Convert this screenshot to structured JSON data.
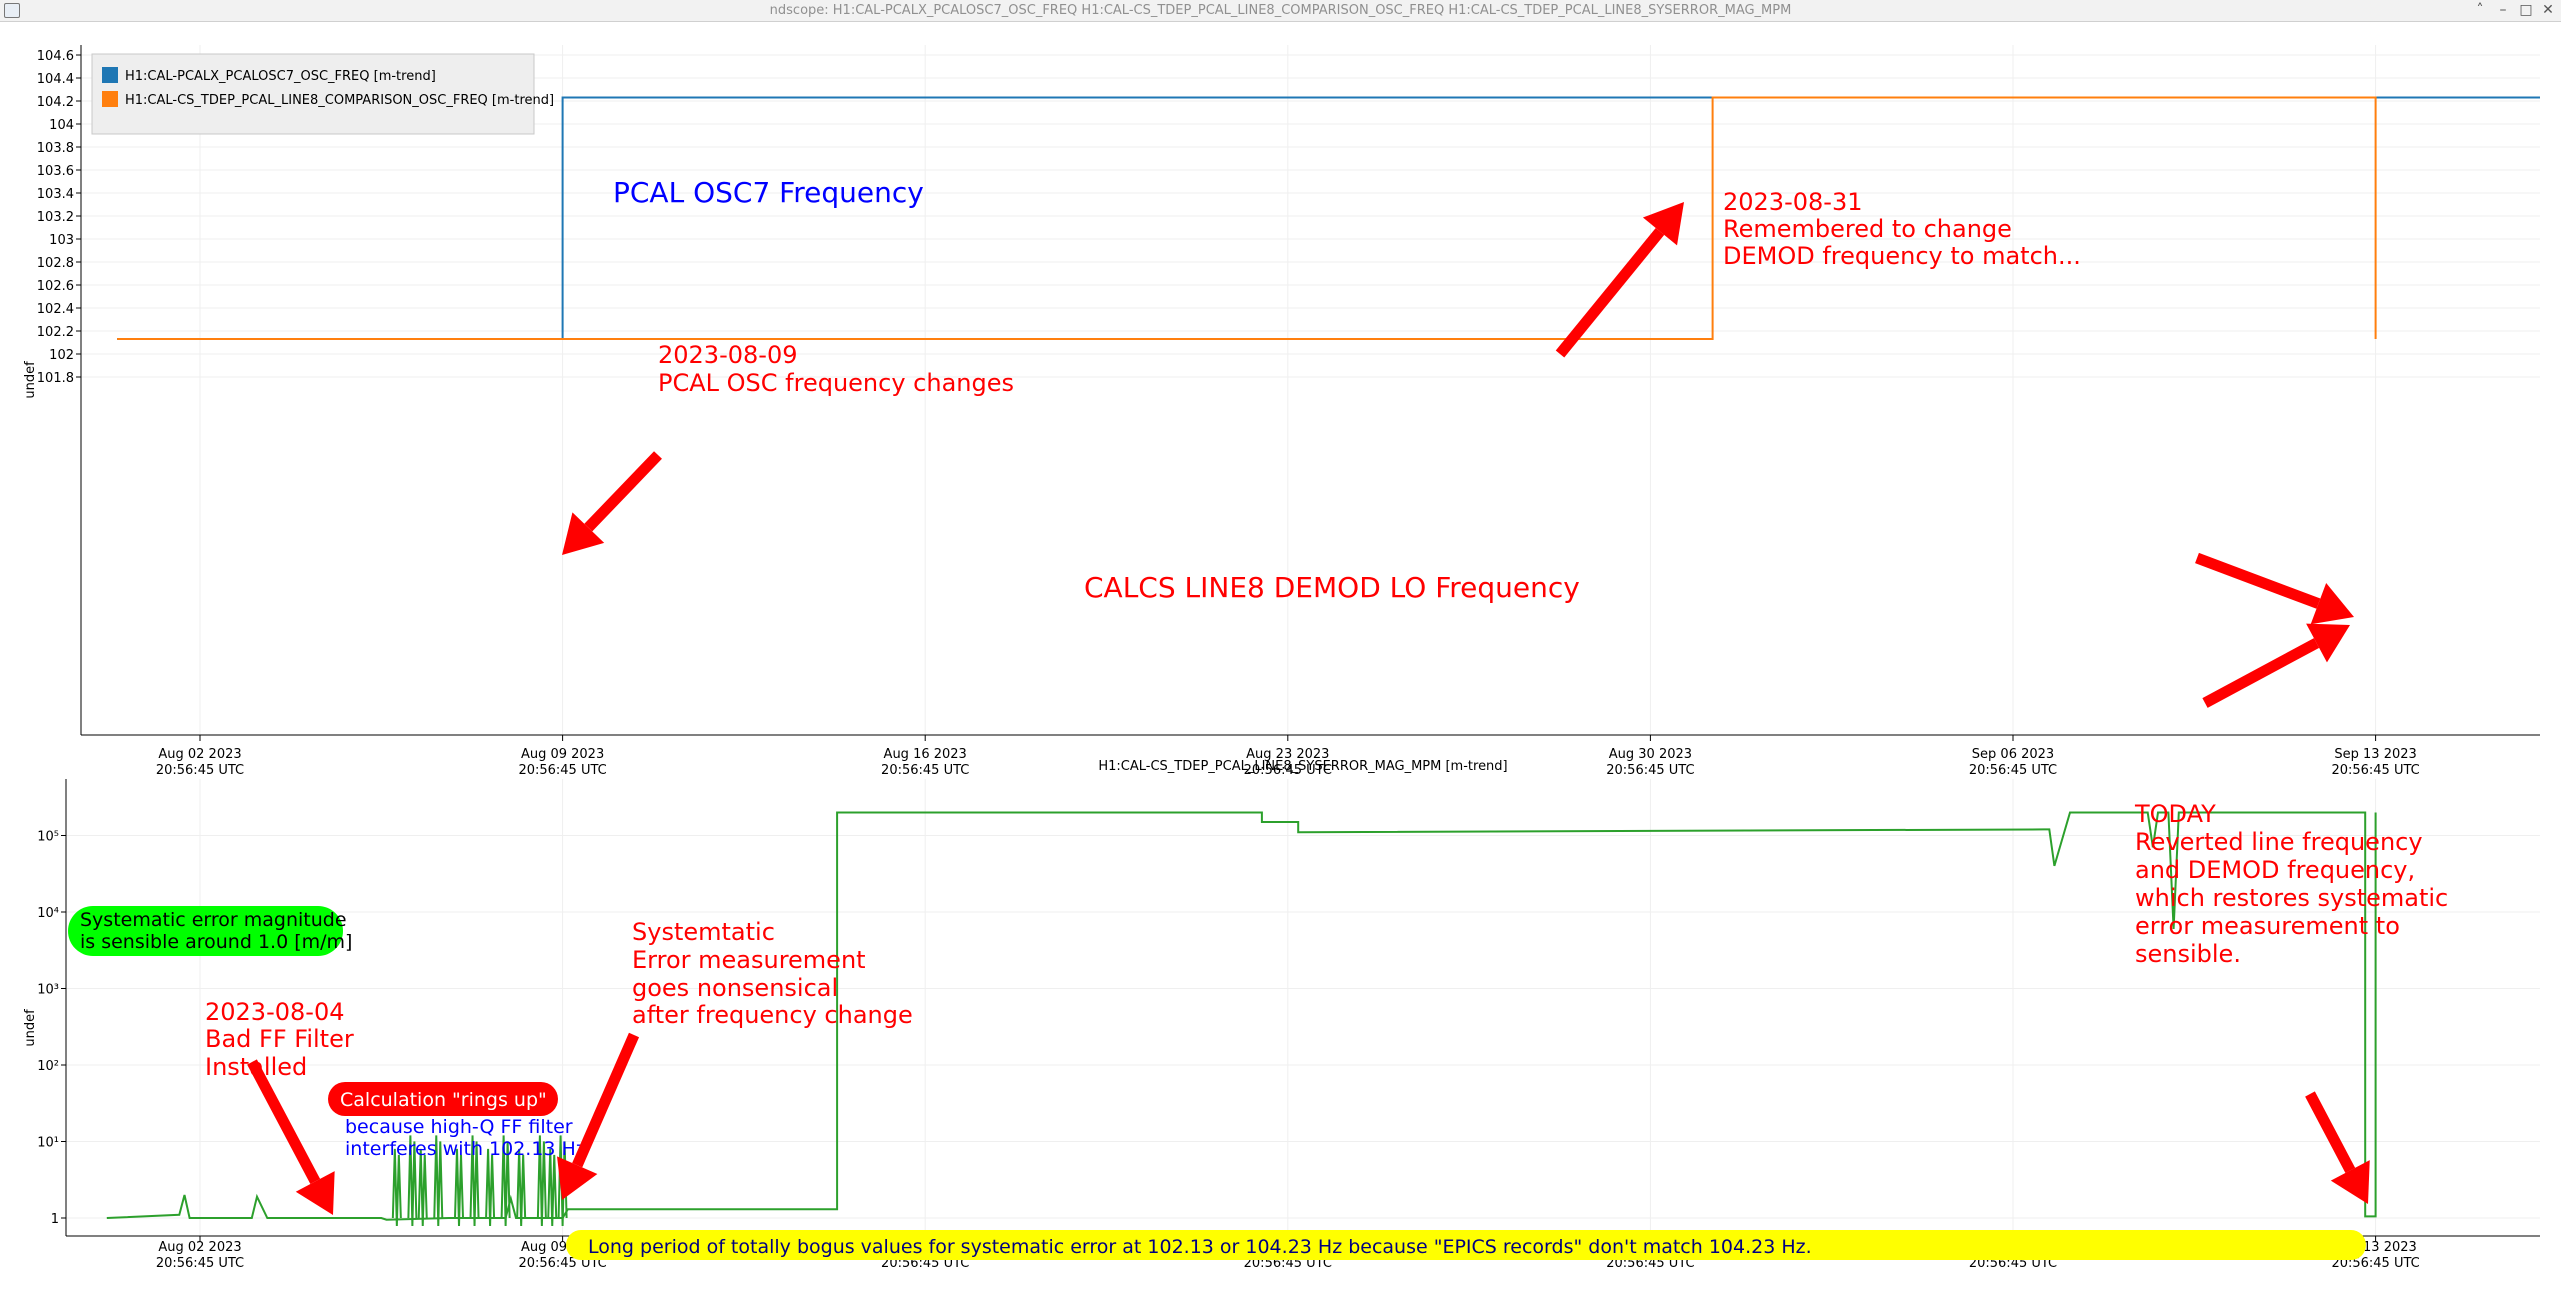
{
  "window": {
    "title": "ndscope: H1:CAL-PCALX_PCALOSC7_OSC_FREQ H1:CAL-CS_TDEP_PCAL_LINE8_COMPARISON_OSC_FREQ H1:CAL-CS_TDEP_PCAL_LINE8_SYSERROR_MAG_MPM",
    "controls": [
      "˄",
      "–",
      "□",
      "✕"
    ]
  },
  "colors": {
    "blue": "#1f77b4",
    "orange": "#ff7f0e",
    "green": "#2ca02c",
    "red": "#ff0000",
    "yellow": "#ffff00",
    "lime": "#00ff00"
  },
  "chart_data": [
    {
      "type": "line",
      "ylabel": "undef",
      "ylim": [
        101.7,
        104.65
      ],
      "x_ticks": [
        [
          "Aug 02 2023",
          "20:56:45 UTC"
        ],
        [
          "Aug 09 2023",
          "20:56:45 UTC"
        ],
        [
          "Aug 16 2023",
          "20:56:45 UTC"
        ],
        [
          "Aug 23 2023",
          "20:56:45 UTC"
        ],
        [
          "Aug 30 2023",
          "20:56:45 UTC"
        ],
        [
          "Sep 06 2023",
          "20:56:45 UTC"
        ],
        [
          "Sep 13 2023",
          "20:56:45 UTC"
        ]
      ],
      "y_ticks": [
        "104.6",
        "104.4",
        "104.2",
        "104",
        "103.8",
        "103.6",
        "103.4",
        "103.2",
        "103",
        "102.8",
        "102.6",
        "102.4",
        "102.2",
        "102",
        "101.8"
      ],
      "grid": true,
      "legend_position": "top-left",
      "series": [
        {
          "name": "H1:CAL-PCALX_PCALOSC7_OSC_FREQ [m-trend]",
          "color": "#1f77b4",
          "x_days": [
            -1.6,
            7.0,
            7.0,
            46.0
          ],
          "y": [
            102.13,
            102.13,
            104.23,
            104.23
          ]
        },
        {
          "name": "H1:CAL-CS_TDEP_PCAL_LINE8_COMPARISON_OSC_FREQ [m-trend]",
          "color": "#ff7f0e",
          "x_days": [
            -1.6,
            29.2,
            29.2,
            42.0,
            42.0
          ],
          "y": [
            102.13,
            102.13,
            104.23,
            104.23,
            102.13
          ]
        }
      ],
      "annotations": [
        {
          "text": "PCAL OSC7 Frequency",
          "color": "#0000ff"
        },
        {
          "lines": [
            "2023-08-09",
            "PCAL OSC frequency changes"
          ],
          "color": "#ff0000"
        },
        {
          "lines": [
            "2023-08-31",
            "Remembered to change",
            "DEMOD frequency to match..."
          ],
          "color": "#ff0000"
        },
        {
          "text": "CALCS LINE8 DEMOD LO Frequency",
          "color": "#ff0000"
        }
      ]
    },
    {
      "type": "line",
      "title": "H1:CAL-CS_TDEP_PCAL_LINE8_SYSERROR_MAG_MPM [m-trend]",
      "ylabel": "undef",
      "scale": "log",
      "y_ticks": [
        "10⁵",
        "10⁴",
        "10³",
        "10²",
        "10¹",
        "1"
      ],
      "x_ticks": [
        [
          "Aug 02 2023",
          "20:56:45 UTC"
        ],
        [
          "Aug 09 2023",
          "20:56:45 UTC"
        ],
        [
          "Aug 16 2023",
          "20:56:45 UTC"
        ],
        [
          "Aug 23 2023",
          "20:56:45 UTC"
        ],
        [
          "Aug 30 2023",
          "20:56:45 UTC"
        ],
        [
          "Sep 06 2023",
          "20:56:45 UTC"
        ],
        [
          "Sep 13 2023",
          "20:56:45 UTC"
        ]
      ],
      "grid": true,
      "series": [
        {
          "color": "#2ca02c",
          "points": [
            [
              -1.8,
              1
            ],
            [
              -0.4,
              1.1
            ],
            [
              -0.3,
              2
            ],
            [
              -0.2,
              1
            ],
            [
              1.0,
              1
            ],
            [
              1.1,
              1.9
            ],
            [
              1.3,
              1
            ],
            [
              3.5,
              1
            ],
            [
              3.6,
              0.95
            ],
            [
              4.8,
              1
            ],
            [
              5.9,
              1
            ],
            [
              6.0,
              1.8
            ],
            [
              6.1,
              1
            ],
            [
              7.0,
              1
            ],
            [
              7.1,
              1.3
            ],
            [
              12.3,
              1.3
            ],
            [
              12.3,
              200000
            ],
            [
              20.5,
              200000
            ],
            [
              20.5,
              150000
            ],
            [
              21.2,
              150000
            ],
            [
              21.2,
              110000
            ],
            [
              35.6,
              120000
            ],
            [
              35.7,
              120000
            ],
            [
              35.8,
              40000
            ],
            [
              36.1,
              200000
            ],
            [
              37.6,
              200000
            ],
            [
              37.7,
              70000
            ],
            [
              37.8,
              200000
            ],
            [
              38.0,
              200000
            ],
            [
              38.1,
              6000
            ],
            [
              38.2,
              200000
            ],
            [
              41.8,
              200000
            ],
            [
              41.8,
              1.05
            ],
            [
              42.0,
              1.05
            ],
            [
              42.0,
              200000
            ]
          ],
          "spikes_x": [
            3.8,
            4.1,
            4.3,
            4.6,
            5.0,
            5.3,
            5.6,
            5.9,
            6.2,
            6.6,
            6.8,
            7.0
          ]
        }
      ],
      "annotations": [
        {
          "lines": [
            "Systematic error magnitude",
            "is sensible around 1.0 [m/m]"
          ],
          "color": "#000000",
          "highlight": "#00ff00"
        },
        {
          "lines": [
            "2023-08-04",
            "Bad FF Filter",
            "Installed"
          ],
          "color": "#ff0000"
        },
        {
          "text": "Calculation \"rings up\"",
          "color": "#ffffff",
          "highlight": "#ff0000"
        },
        {
          "lines": [
            "because high-Q FF filter",
            "interferes with 102.13 Hz"
          ],
          "color": "#0000ff"
        },
        {
          "lines": [
            "Systemtatic",
            "Error measurement",
            "goes nonsensical",
            "after frequency change"
          ],
          "color": "#ff0000"
        },
        {
          "lines": [
            "TODAY",
            "Reverted line frequency",
            "and DEMOD frequency,",
            "which restores systematic",
            "error measurement to",
            "sensible."
          ],
          "color": "#ff0000"
        },
        {
          "text": "Long period of totally bogus values for systematic error at 102.13 or 104.23 Hz because \"EPICS records\" don't match 104.23 Hz.",
          "color": "#000080",
          "highlight": "#ffff00"
        }
      ]
    }
  ]
}
